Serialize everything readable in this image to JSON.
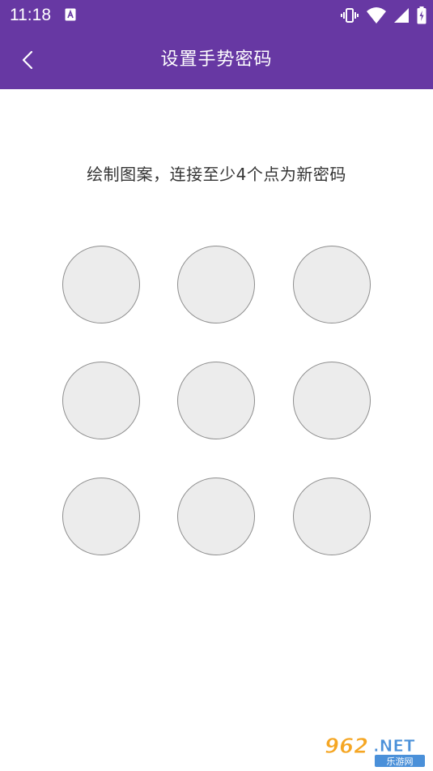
{
  "status_bar": {
    "time": "11:18",
    "notification_icon": "a-badge-icon",
    "icons": [
      "vibrate-icon",
      "wifi-icon",
      "cellular-signal-icon",
      "battery-icon"
    ]
  },
  "header": {
    "back_icon": "chevron-left-icon",
    "title": "设置手势密码"
  },
  "main": {
    "instruction": "绘制图案，连接至少4个点为新密码",
    "pattern": {
      "rows": 3,
      "columns": 3,
      "selected_count": 0
    }
  },
  "watermark": {
    "text": "962.NET",
    "subtext": "乐游网"
  },
  "colors": {
    "primary": "#6738a3",
    "dot_fill": "#ececec",
    "dot_border": "#8e8e8e",
    "instruction_text": "#333333"
  }
}
